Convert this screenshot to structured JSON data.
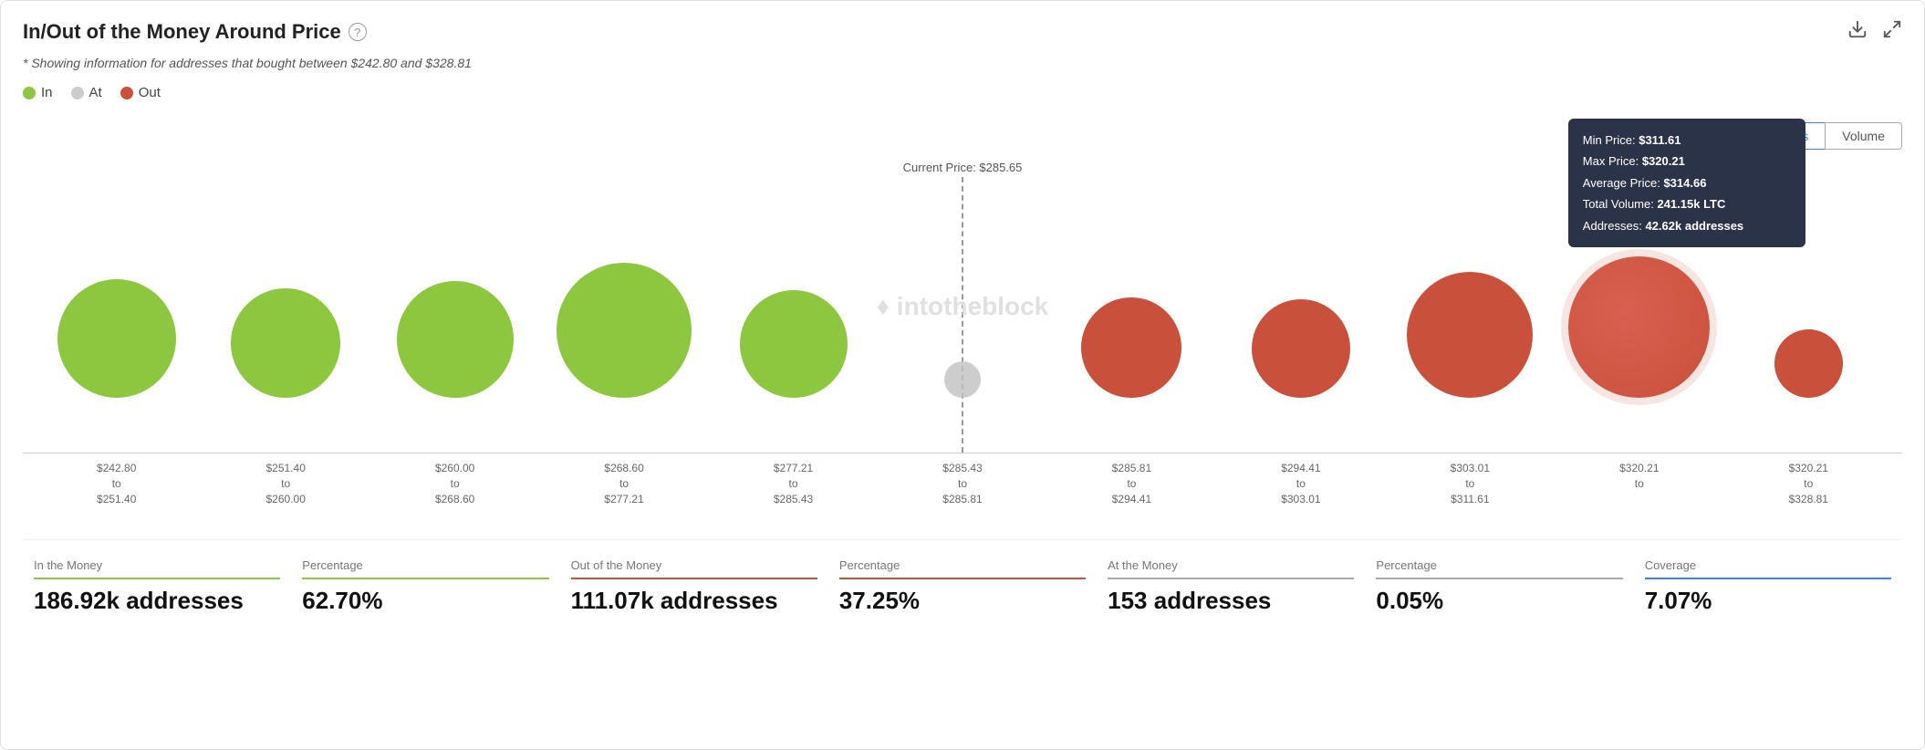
{
  "header": {
    "title": "In/Out of the Money Around Price",
    "help_icon": "?",
    "download_icon": "⬇",
    "expand_icon": "⤢"
  },
  "subtitle": "* Showing information for addresses that bought between $242.80 and $328.81",
  "legend": [
    {
      "label": "In",
      "color": "green"
    },
    {
      "label": "At",
      "color": "gray"
    },
    {
      "label": "Out",
      "color": "red"
    }
  ],
  "toggle": {
    "addresses_label": "Addresses",
    "volume_label": "Volume"
  },
  "chart": {
    "current_price_label": "Current Price: $285.65",
    "watermark": "intotheblock",
    "bubbles": [
      {
        "type": "green",
        "size": 130,
        "range_top": "$242.80",
        "range_bot": "$251.40"
      },
      {
        "type": "green",
        "size": 120,
        "range_top": "$251.40",
        "range_bot": "$260.00"
      },
      {
        "type": "green",
        "size": 128,
        "range_top": "$260.00",
        "range_bot": "$268.60"
      },
      {
        "type": "green",
        "size": 148,
        "range_top": "$268.60",
        "range_bot": "$277.21"
      },
      {
        "type": "green",
        "size": 118,
        "range_top": "$277.21",
        "range_bot": "$285.43"
      },
      {
        "type": "gray",
        "size": 40,
        "range_top": "$285.43",
        "range_bot": "$285.81"
      },
      {
        "type": "red",
        "size": 110,
        "range_top": "$285.81",
        "range_bot": "$294.41"
      },
      {
        "type": "red",
        "size": 108,
        "range_top": "$294.41",
        "range_bot": "$303.01"
      },
      {
        "type": "red",
        "size": 138,
        "range_top": "$303.01",
        "range_bot": "$311.61"
      },
      {
        "type": "red-highlight",
        "size": 155,
        "range_top": "$311.61 (tooltip)",
        "range_bot": "$320.21"
      },
      {
        "type": "red",
        "size": 75,
        "range_top": "$320.21",
        "range_bot": "$328.81"
      }
    ],
    "axis_labels": [
      {
        "line1": "$242.80",
        "line2": "to",
        "line3": "$251.40"
      },
      {
        "line1": "$251.40",
        "line2": "to",
        "line3": "$260.00"
      },
      {
        "line1": "$260.00",
        "line2": "to",
        "line3": "$268.60"
      },
      {
        "line1": "$268.60",
        "line2": "to",
        "line3": "$277.21"
      },
      {
        "line1": "$277.21",
        "line2": "to",
        "line3": "$285.43"
      },
      {
        "line1": "$285.43",
        "line2": "to",
        "line3": "$285.81"
      },
      {
        "line1": "$285.81",
        "line2": "to",
        "line3": "$294.41"
      },
      {
        "line1": "$294.41",
        "line2": "to",
        "line3": "$303.01"
      },
      {
        "line1": "$303.01",
        "line2": "to",
        "line3": "$311.61"
      },
      {
        "line1": "$320.21",
        "line2": "to",
        "line3": ""
      },
      {
        "line1": "$320.21",
        "line2": "to",
        "line3": "$328.81"
      }
    ]
  },
  "tooltip": {
    "min_price_label": "Min Price:",
    "min_price_value": "$311.61",
    "max_price_label": "Max Price:",
    "max_price_value": "$320.21",
    "avg_price_label": "Average Price:",
    "avg_price_value": "$314.66",
    "total_vol_label": "Total Volume:",
    "total_vol_value": "241.15k LTC",
    "addresses_label": "Addresses:",
    "addresses_value": "42.62k addresses"
  },
  "stats": [
    {
      "label": "In the Money",
      "color_class": "green",
      "value": "186.92k addresses"
    },
    {
      "label": "Percentage",
      "color_class": "green",
      "value": "62.70%"
    },
    {
      "label": "Out of the Money",
      "color_class": "red",
      "value": "111.07k addresses"
    },
    {
      "label": "Percentage",
      "color_class": "red",
      "value": "37.25%"
    },
    {
      "label": "At the Money",
      "color_class": "gray",
      "value": "153 addresses"
    },
    {
      "label": "Percentage",
      "color_class": "gray",
      "value": "0.05%"
    },
    {
      "label": "Coverage",
      "color_class": "blue",
      "value": "7.07%"
    }
  ]
}
